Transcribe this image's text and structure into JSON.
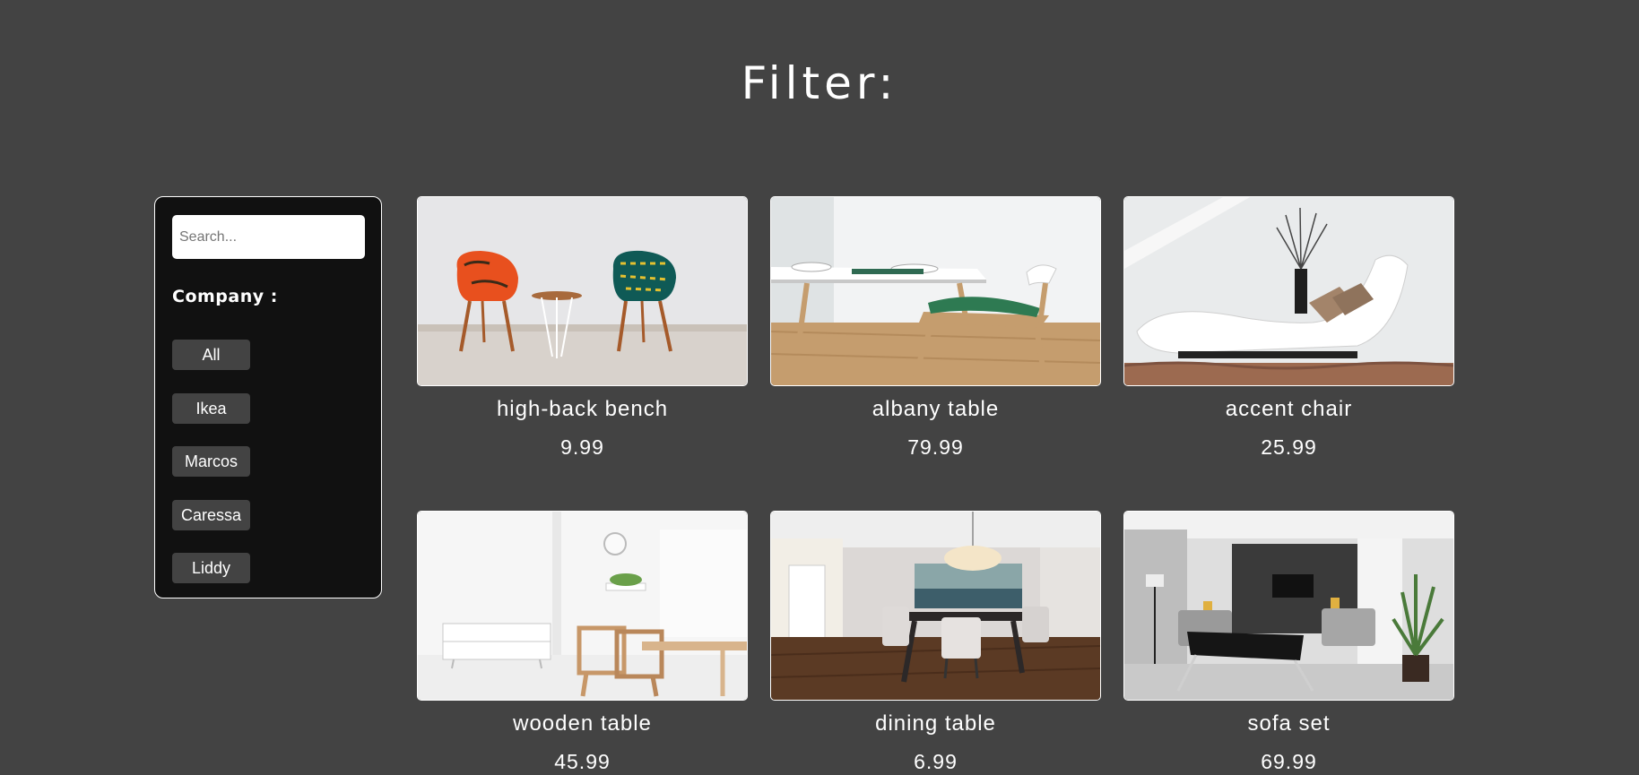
{
  "header": {
    "title": "Filter:"
  },
  "sidebar": {
    "search": {
      "placeholder": "Search...",
      "value": ""
    },
    "company_label": "Company :",
    "companies": [
      "All",
      "Ikea",
      "Marcos",
      "Caressa",
      "Liddy"
    ]
  },
  "products": [
    {
      "name": "high-back bench",
      "price": "9.99",
      "image": "two-accent-chairs-photo"
    },
    {
      "name": "albany table",
      "price": "79.99",
      "image": "dining-table-chair-photo"
    },
    {
      "name": "accent chair",
      "price": "25.99",
      "image": "white-chaise-lounge-photo"
    },
    {
      "name": "wooden table",
      "price": "45.99",
      "image": "white-room-wooden-table-photo"
    },
    {
      "name": "dining table",
      "price": "6.99",
      "image": "dining-room-photo"
    },
    {
      "name": "sofa set",
      "price": "69.99",
      "image": "living-room-sofa-photo"
    }
  ],
  "colors": {
    "page_background": "#434343",
    "sidebar_background": "#111111",
    "button_background": "#434343",
    "text": "#ffffff"
  }
}
